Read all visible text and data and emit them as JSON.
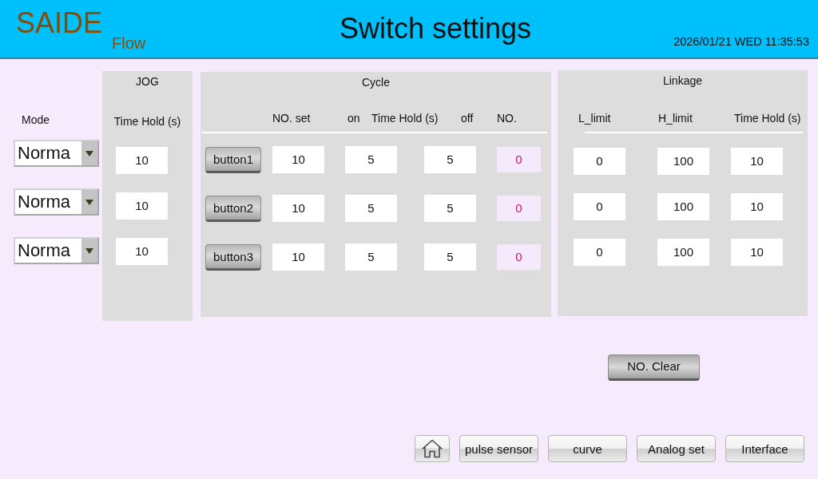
{
  "header": {
    "logo": "SAIDE",
    "logo_sub": "Flow",
    "title": "Switch settings",
    "datetime": "2026/01/21 WED 11:35:53"
  },
  "mode": {
    "label": "Mode",
    "dropdowns": [
      {
        "value": "Norma"
      },
      {
        "value": "Norma"
      },
      {
        "value": "Norma"
      }
    ]
  },
  "jog": {
    "title": "JOG",
    "column": "Time Hold (s)",
    "values": [
      "10",
      "10",
      "10"
    ]
  },
  "cycle": {
    "title": "Cycle",
    "columns": [
      "NO. set",
      "on",
      "Time Hold (s)",
      "off",
      "NO."
    ],
    "rows": [
      {
        "button": "button1",
        "no_set": "10",
        "on": "5",
        "off": "5",
        "count": "0"
      },
      {
        "button": "button2",
        "no_set": "10",
        "on": "5",
        "off": "5",
        "count": "0"
      },
      {
        "button": "button3",
        "no_set": "10",
        "on": "5",
        "off": "5",
        "count": "0"
      }
    ]
  },
  "linkage": {
    "title": "Linkage",
    "columns": [
      "L_limit",
      "H_limit",
      "Time Hold (s)"
    ],
    "rows": [
      {
        "l_limit": "0",
        "h_limit": "100",
        "time_hold": "10"
      },
      {
        "l_limit": "0",
        "h_limit": "100",
        "time_hold": "10"
      },
      {
        "l_limit": "0",
        "h_limit": "100",
        "time_hold": "10"
      }
    ]
  },
  "clear_button": "NO. Clear",
  "nav": [
    {
      "kind": "home"
    },
    {
      "kind": "text",
      "label": "pulse sensor"
    },
    {
      "kind": "text",
      "label": "curve"
    },
    {
      "kind": "text",
      "label": "Analog set"
    },
    {
      "kind": "text",
      "label": "Interface"
    }
  ]
}
